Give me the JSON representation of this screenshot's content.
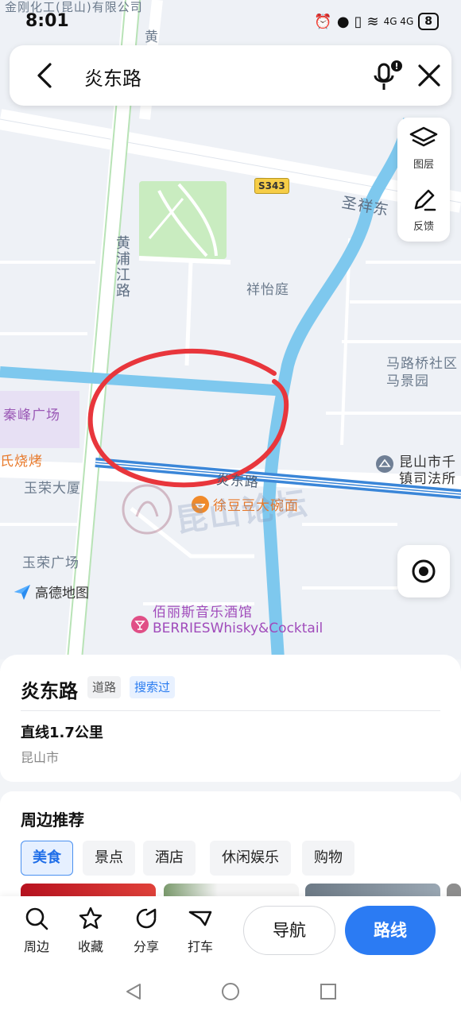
{
  "status_bar": {
    "time": "8:01",
    "network_labels": "4G 4G",
    "battery": "8"
  },
  "search": {
    "query": "炎东路"
  },
  "map_tools": {
    "layers_label": "图层",
    "feedback_label": "反馈"
  },
  "map": {
    "labels": {
      "company_partial": "金刚化工(昆山)有限公司",
      "huang_top": "黄",
      "highway_badge": "S343",
      "shengxiang_road": "圣祥东",
      "huangpujiang_road": "黄浦江路",
      "xiangyiting": "祥怡庭",
      "malu_community": "马路桥社区马景园",
      "qinfeng_plaza": "秦峰广场",
      "bbq_partial": "氏烧烤",
      "yurong_building": "玉荣大厦",
      "yandong_road": "炎东路",
      "court": "昆山市千镇司法所",
      "noodle_shop": "徐豆豆大碗面",
      "yurong_plaza": "玉荣广场",
      "bar_name": "佰丽斯音乐酒馆",
      "bar_english": "BERRIESWhisky&Cocktail",
      "watermark": "昆山论坛",
      "amap_brand": "高德地图"
    }
  },
  "place": {
    "name": "炎东路",
    "tag_type": "道路",
    "tag_searched": "搜索过",
    "distance": "直线1.7公里",
    "city": "昆山市"
  },
  "nearby": {
    "heading": "周边推荐",
    "categories": [
      "美食",
      "景点",
      "酒店",
      "休闲娱乐",
      "购物"
    ],
    "active_index": 0
  },
  "actions": {
    "nearby": "周边",
    "favorite": "收藏",
    "share": "分享",
    "taxi": "打车",
    "navigate": "导航",
    "route": "路线"
  },
  "colors": {
    "primary_blue": "#2b7bf3",
    "river": "#7ec8ee",
    "park": "#c9ecc0",
    "annotation_red": "#e8363c",
    "poi_orange": "#e8792a",
    "poi_purple": "#a04bbb"
  }
}
